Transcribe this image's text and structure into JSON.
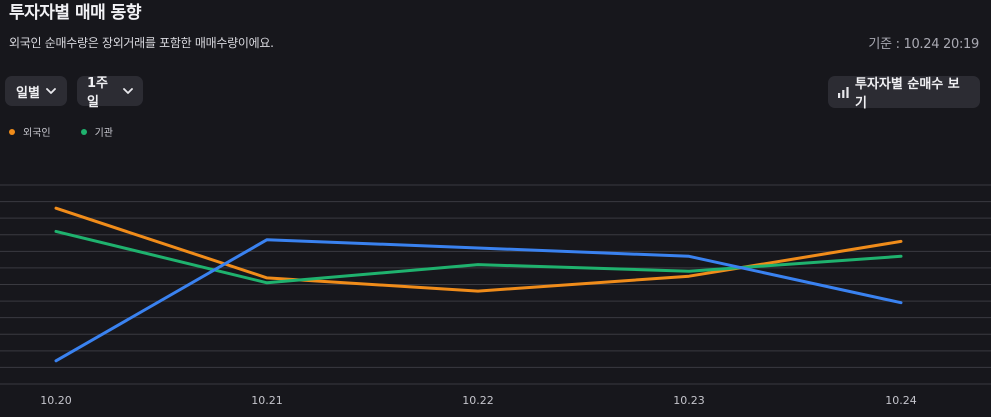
{
  "header": {
    "title": "투자자별 매매 동향",
    "subtitle": "외국인 순매수량은 장외거래를 포함한 매매수량이에요.",
    "timestamp": "기준 : 10.24 20:19"
  },
  "controls": {
    "period": "일별",
    "range": "1주일",
    "view_button": "투자자별 순매수 보기"
  },
  "legend": [
    {
      "label": "외국인",
      "color": "#f08c1a"
    },
    {
      "label": "기관",
      "color": "#1fb26e"
    }
  ],
  "chart_data": {
    "type": "line",
    "categories": [
      "10.20",
      "10.21",
      "10.22",
      "10.23",
      "10.24"
    ],
    "grid": true,
    "ylim": [
      0,
      12
    ],
    "series": [
      {
        "name": "외국인",
        "color": "#f08c1a",
        "values": [
          10.6,
          6.4,
          5.6,
          6.5,
          8.6
        ]
      },
      {
        "name": "기관",
        "color": "#1fb26e",
        "values": [
          9.2,
          6.1,
          7.2,
          6.8,
          7.7
        ]
      },
      {
        "color": "#3a82f0",
        "values": [
          1.4,
          8.7,
          8.2,
          7.7,
          4.9
        ]
      }
    ]
  }
}
